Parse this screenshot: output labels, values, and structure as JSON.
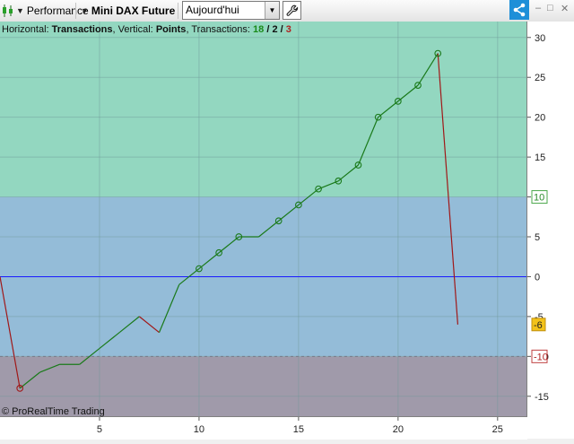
{
  "toolbar": {
    "performance_label": "Performance",
    "instrument_label": "Mini DAX Future",
    "period_value": "Aujourd'hui",
    "icons": [
      "dropdown-arrow-icon",
      "wrench-icon",
      "share-icon",
      "minimize-icon",
      "maximize-icon",
      "close-icon"
    ],
    "win_min": "–",
    "win_max": "□",
    "win_close": "✕"
  },
  "info": {
    "h_label": "Horizontal:",
    "h_value": "Transactions",
    "v_label": ", Vertical:",
    "v_value": "Points",
    "t_label": ", Transactions:",
    "wins": "18",
    "sep1": " / ",
    "neutral": "2",
    "sep2": " / ",
    "losses": "3"
  },
  "copyright": "© ProRealTime Trading",
  "colors": {
    "zone_top": "#93d7c0",
    "zone_mid": "#94bcd8",
    "zone_low": "#a09aaa",
    "line_up": "#1a7a1a",
    "line_down": "#a01818",
    "zero_line": "#1a1aff",
    "accent": "#1e8fd8",
    "last_value_bg": "#f2c21a"
  },
  "chart_data": {
    "type": "line",
    "x_ticks": [
      5,
      10,
      15,
      20,
      25
    ],
    "y_ticks": [
      30,
      25,
      20,
      15,
      10,
      5,
      0,
      -5,
      -10,
      -15
    ],
    "xlim": [
      0,
      26
    ],
    "ylim": [
      -17.5,
      32
    ],
    "zones": [
      {
        "from": 10,
        "to": 32,
        "label": "10"
      },
      {
        "from": -10,
        "to": 10
      },
      {
        "from": -17.5,
        "to": -10,
        "label": "-10"
      }
    ],
    "last_value": {
      "value": -6,
      "label": "-6"
    },
    "x": [
      0,
      1,
      2,
      3,
      4,
      5,
      6,
      7,
      8,
      9,
      10,
      11,
      12,
      13,
      14,
      15,
      16,
      17,
      18,
      19,
      20,
      21,
      22,
      23
    ],
    "y": [
      0,
      -14,
      -12,
      -11,
      -11,
      -9,
      -7,
      -5,
      -7,
      -1,
      1,
      3,
      5,
      5,
      7,
      9,
      11,
      12,
      14,
      20,
      22,
      24,
      28,
      -6
    ],
    "markers": [
      1,
      10,
      11,
      12,
      14,
      15,
      16,
      17,
      18,
      19,
      20,
      21,
      22
    ],
    "down_segments": [
      [
        0,
        1
      ],
      [
        7,
        8
      ],
      [
        22,
        23
      ]
    ]
  }
}
